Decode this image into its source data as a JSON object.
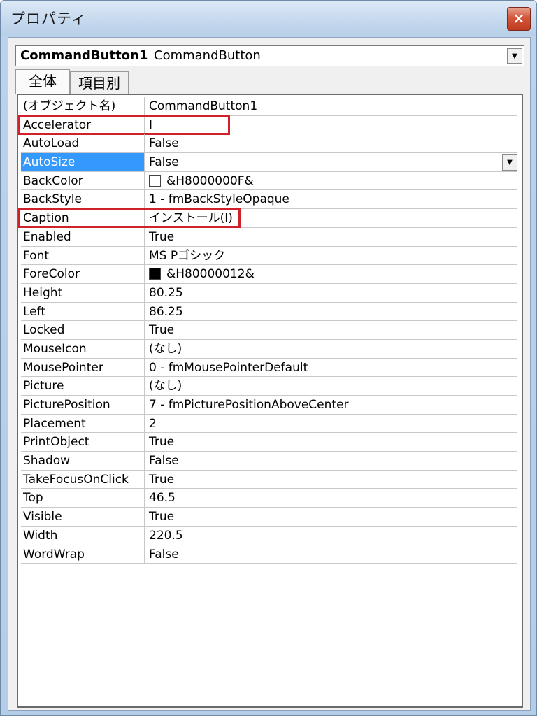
{
  "window": {
    "title": "プロパティ",
    "close_label": "×"
  },
  "object_selector": {
    "name": "CommandButton1",
    "type": "CommandButton",
    "dropdown_glyph": "▼"
  },
  "tabs": [
    {
      "label": "全体",
      "active": true
    },
    {
      "label": "項目別",
      "active": false
    }
  ],
  "properties": [
    {
      "name": "(オブジェクト名)",
      "value": "CommandButton1"
    },
    {
      "name": "Accelerator",
      "value": "I",
      "highlighted": true
    },
    {
      "name": "AutoLoad",
      "value": "False"
    },
    {
      "name": "AutoSize",
      "value": "False",
      "selected": true
    },
    {
      "name": "BackColor",
      "value": "&H8000000F&",
      "swatch": "#ffffff"
    },
    {
      "name": "BackStyle",
      "value": "1 - fmBackStyleOpaque"
    },
    {
      "name": "Caption",
      "value": "インストール(I)",
      "highlighted": true
    },
    {
      "name": "Enabled",
      "value": "True"
    },
    {
      "name": "Font",
      "value": "MS Pゴシック"
    },
    {
      "name": "ForeColor",
      "value": "&H80000012&",
      "swatch": "#000000"
    },
    {
      "name": "Height",
      "value": "80.25"
    },
    {
      "name": "Left",
      "value": "86.25"
    },
    {
      "name": "Locked",
      "value": "True"
    },
    {
      "name": "MouseIcon",
      "value": "(なし)"
    },
    {
      "name": "MousePointer",
      "value": "0 - fmMousePointerDefault"
    },
    {
      "name": "Picture",
      "value": "(なし)"
    },
    {
      "name": "PicturePosition",
      "value": "7 - fmPicturePositionAboveCenter"
    },
    {
      "name": "Placement",
      "value": "2"
    },
    {
      "name": "PrintObject",
      "value": "True"
    },
    {
      "name": "Shadow",
      "value": "False"
    },
    {
      "name": "TakeFocusOnClick",
      "value": "True"
    },
    {
      "name": "Top",
      "value": "46.5"
    },
    {
      "name": "Visible",
      "value": "True"
    },
    {
      "name": "Width",
      "value": "220.5"
    },
    {
      "name": "WordWrap",
      "value": "False"
    }
  ],
  "colors": {
    "selection": "#3399ff",
    "highlight_box": "#d0202a"
  }
}
